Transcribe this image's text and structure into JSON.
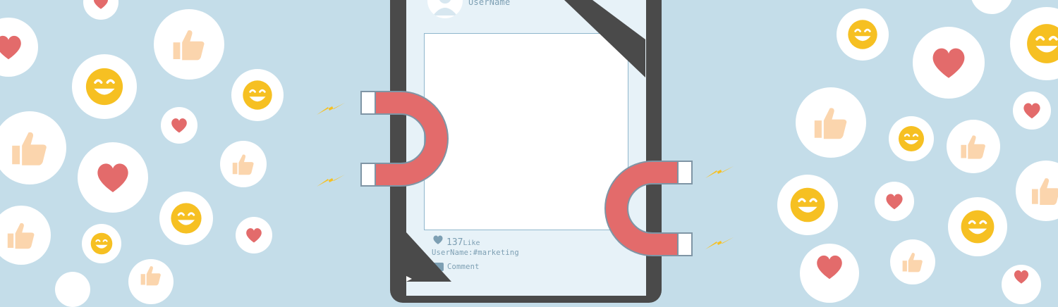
{
  "colors": {
    "background": "#c4dde9",
    "bubble": "#ffffff",
    "heart": "#e36b6b",
    "smile": "#f6c022",
    "thumb": "#fbd5ad",
    "magnet": "#e36b6b",
    "phone_frame": "#4a4a4a",
    "spark": "#f6c022"
  },
  "post": {
    "author": "UserName",
    "like_count": "137",
    "like_label": "Like",
    "caption": "UserName:#marketing",
    "comment_label": "Comment"
  },
  "icons": {
    "left_bubbles": [
      "thumbs-up-icon",
      "heart-icon",
      "smile-icon",
      "smile-icon",
      "heart-icon",
      "thumbs-up-icon",
      "smile-icon",
      "heart-icon",
      "thumbs-up-icon"
    ],
    "right_bubbles": [
      "smile-icon",
      "heart-icon",
      "smile-icon",
      "thumbs-up-icon",
      "heart-icon",
      "smile-icon",
      "thumbs-up-icon",
      "heart-icon",
      "smile-icon"
    ],
    "magnets": [
      "magnet-icon",
      "magnet-icon"
    ]
  }
}
